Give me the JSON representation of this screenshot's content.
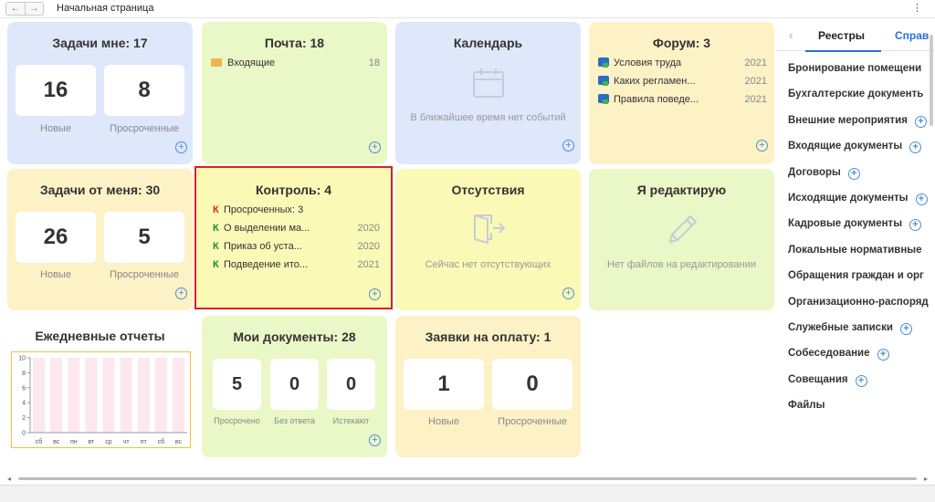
{
  "window": {
    "title": "Начальная страница",
    "back": "←",
    "forward": "→",
    "menu": "⋮"
  },
  "tasks_to_me": {
    "title": "Задачи мне: 17",
    "new_value": "16",
    "new_label": "Новые",
    "overdue_value": "8",
    "overdue_label": "Просроченные"
  },
  "mail": {
    "title": "Почта: 18",
    "folder": "Входящие",
    "folder_count": "18"
  },
  "calendar": {
    "title": "Календарь",
    "empty": "В ближайшее время нет событий"
  },
  "forum": {
    "title": "Форум: 3",
    "items": [
      {
        "text": "Условия труда",
        "year": "2021"
      },
      {
        "text": "Каких регламен...",
        "year": "2021"
      },
      {
        "text": "Правила поведе...",
        "year": "2021"
      }
    ]
  },
  "tasks_from_me": {
    "title": "Задачи от меня: 30",
    "new_value": "26",
    "new_label": "Новые",
    "overdue_value": "5",
    "overdue_label": "Просроченные"
  },
  "control": {
    "title": "Контроль: 4",
    "marker": "К",
    "items": [
      {
        "text": "Просроченных: 3",
        "year": "",
        "status": "overdue"
      },
      {
        "text": "О выделении ма...",
        "year": "2020",
        "status": "ok"
      },
      {
        "text": "Приказ об уста...",
        "year": "2020",
        "status": "ok"
      },
      {
        "text": "Подведение ито...",
        "year": "2021",
        "status": "ok"
      }
    ]
  },
  "absences": {
    "title": "Отсутствия",
    "empty": "Сейчас нет отсутствующих"
  },
  "editing": {
    "title": "Я редактирую",
    "empty": "Нет файлов на редактировании"
  },
  "daily_reports": {
    "title": "Ежедневные отчеты"
  },
  "my_docs": {
    "title": "Мои документы: 28",
    "overdue_value": "5",
    "overdue_label": "Просрочено",
    "noanswer_value": "0",
    "noanswer_label": "Без ответа",
    "expiring_value": "0",
    "expiring_label": "Истекают"
  },
  "payments": {
    "title": "Заявки на оплату: 1",
    "new_value": "1",
    "new_label": "Новые",
    "overdue_value": "0",
    "overdue_label": "Просроченные"
  },
  "right_panel": {
    "tab_active": "Реестры",
    "tab_other": "Справ",
    "items": [
      {
        "label": "Бронирование помещени",
        "plus": false
      },
      {
        "label": "Бухгалтерские документь",
        "plus": false
      },
      {
        "label": "Внешние мероприятия",
        "plus": true
      },
      {
        "label": "Входящие документы",
        "plus": true
      },
      {
        "label": "Договоры",
        "plus": true
      },
      {
        "label": "Исходящие документы",
        "plus": true
      },
      {
        "label": "Кадровые документы",
        "plus": true
      },
      {
        "label": "Локальные нормативные",
        "plus": false
      },
      {
        "label": "Обращения граждан и орг",
        "plus": false
      },
      {
        "label": "Организационно-распоряд",
        "plus": false
      },
      {
        "label": "Служебные записки",
        "plus": true
      },
      {
        "label": "Собеседование",
        "plus": true
      },
      {
        "label": "Совещания",
        "plus": true
      },
      {
        "label": "Файлы",
        "plus": false
      }
    ]
  },
  "chart_data": {
    "type": "bar",
    "categories": [
      "сб",
      "вс",
      "пн",
      "вт",
      "ср",
      "чт",
      "пт",
      "сб",
      "вс"
    ],
    "values": [
      0,
      0,
      0,
      0,
      0,
      0,
      0,
      0,
      0
    ],
    "yticks": [
      "0",
      "2",
      "4",
      "6",
      "8",
      "10"
    ],
    "ylim": [
      0,
      10
    ],
    "grid": false,
    "background_band_color": "#fde8ef"
  },
  "colors": {
    "accent": "#2a6fd6",
    "selection": "#e02020",
    "control_ok": "#1e8a2c",
    "control_overdue": "#d22222"
  }
}
